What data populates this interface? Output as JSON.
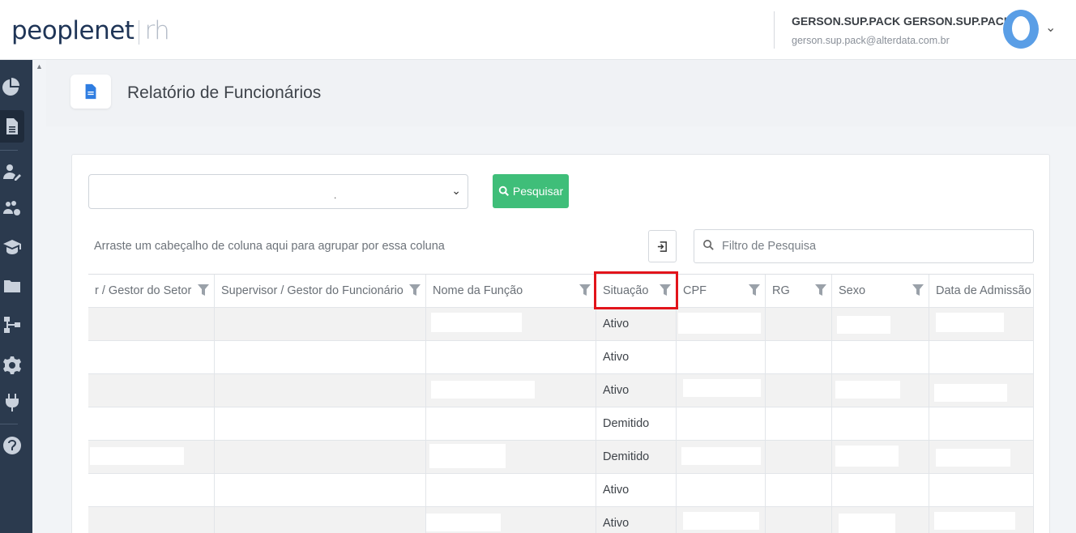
{
  "header": {
    "logo_main": "peoplenet",
    "logo_sub": "rh",
    "user_name": "GERSON.SUP.PACK GERSON.SUP.PACK",
    "user_email": "gerson.sup.pack@alterdata.com.br"
  },
  "sidebar": {
    "items": [
      "chart-pie-icon",
      "document-icon",
      "user-edit-icon",
      "users-cog-icon",
      "graduation-icon",
      "folder-icon",
      "sitemap-icon",
      "gear-icon",
      "plug-icon",
      "help-icon"
    ],
    "active_index": 1
  },
  "page": {
    "title": "Relatório de Funcionários"
  },
  "toolbar": {
    "select_value": ".",
    "search_button": "Pesquisar",
    "group_hint": "Arraste um cabeçalho de coluna aqui para agrupar por essa coluna",
    "filter_placeholder": "Filtro de Pesquisa"
  },
  "table": {
    "columns": [
      "r / Gestor do Setor",
      "Supervisor / Gestor do Funcionário",
      "Nome da Função",
      "Situação",
      "CPF",
      "RG",
      "Sexo",
      "Data de Admissão"
    ],
    "rows": [
      {
        "situacao": "Ativo"
      },
      {
        "situacao": "Ativo"
      },
      {
        "situacao": "Ativo"
      },
      {
        "situacao": "Demitido"
      },
      {
        "situacao": "Demitido"
      },
      {
        "situacao": "Ativo"
      },
      {
        "situacao": "Ativo"
      }
    ]
  },
  "colors": {
    "sidebar_bg": "#2b3a4e",
    "primary_button": "#3fbe79",
    "highlight_border": "#e2141b",
    "brand": "#1f3557"
  }
}
